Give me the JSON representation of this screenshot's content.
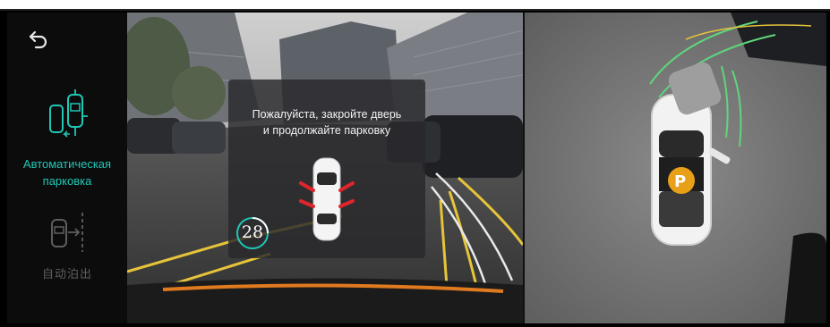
{
  "sidebar": {
    "back": {
      "icon": "back-arrow-icon"
    },
    "modes": [
      {
        "label": "Автоматическая парковка",
        "active": true,
        "icon": "auto-parking-icon",
        "color": "#1fc7b6"
      },
      {
        "label": "自动泊出",
        "active": false,
        "icon": "park-out-icon",
        "color": "#5e5e5e"
      }
    ]
  },
  "dialog": {
    "message_line1": "Пожалуйста, закройте дверь",
    "message_line2": "и продолжайте парковку",
    "countdown": "28",
    "icon": "car-open-doors-icon"
  },
  "colors": {
    "accent": "#1fc7b6",
    "warning": "#e0262b",
    "guide_lines": "#e6c43a"
  }
}
